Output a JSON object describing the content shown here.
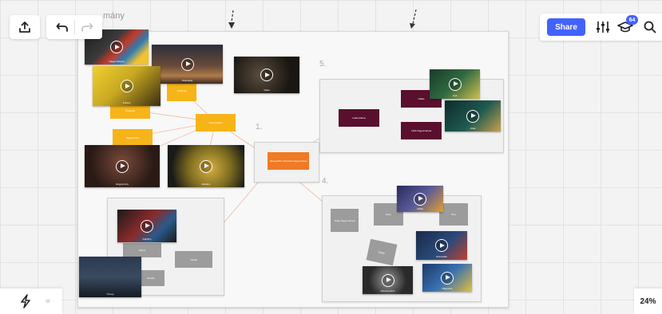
{
  "board": {
    "partial_title": "mány",
    "section_labels": {
      "s1": "1.",
      "s4": "4.",
      "s5": "5."
    }
  },
  "notes": {
    "center": "Hangyaféle szövetek hagyományai",
    "yellow_main": "Kínai kultúra",
    "yellow_a": "Tradíciók",
    "yellow_b": "Ünnepek",
    "yellow_c": "Hagyomány",
    "maroon_main": "India kultúra",
    "maroon_a": "Vallás",
    "maroon_b": "India hagyományai",
    "gray_main": "Afrika hagyományai",
    "gray_a": "Zene",
    "gray_b": "Tánc",
    "gray_c": "Ételek",
    "gray_d": "Viselet",
    "gray_e": "Népek",
    "gray_f": "Rituálé",
    "gray_g": "Szokások"
  },
  "video_captions": {
    "v1": "Hagyományok",
    "v2": "Piramisok",
    "v3": "Video",
    "v4": "Kultúra",
    "v5": "Hagyomány",
    "v6": "Sárkány",
    "v7": "Holi",
    "v8": "India",
    "v9": "Afrika",
    "v10": "Szertartás",
    "v11": "Dokumentum",
    "v12": "Régészet",
    "v13": "Rajzfilm",
    "v14": "Ünnep"
  },
  "toolbar": {
    "share_label": "Share",
    "badge_count": "64",
    "zoom": "24%"
  },
  "icons": {
    "export": "upload-icon",
    "undo": "undo-icon",
    "redo": "redo-icon",
    "settings": "sliders-icon",
    "learn": "graduation-cap-icon",
    "search": "search-icon",
    "lightning": "lightning-icon",
    "collapse": "double-chevron-left-icon"
  }
}
